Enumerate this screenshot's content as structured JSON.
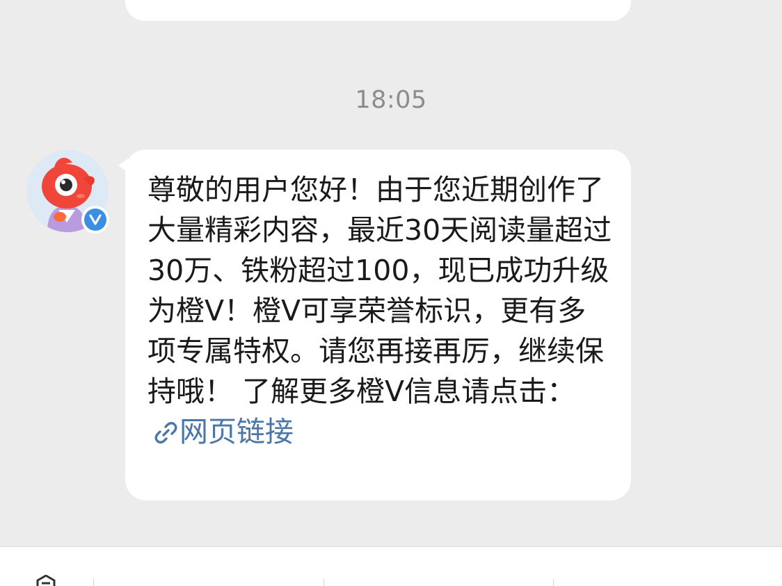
{
  "chat": {
    "timestamp": "18:05",
    "sender": {
      "avatar_icon": "mascot-avatar-icon",
      "badge_icon": "verified-v-icon",
      "badge_color": "#3a8ee6"
    },
    "message": {
      "text": "尊敬的用户您好！由于您近期创作了大量精彩内容，最近30天阅读量超过30万、铁粉超过100，现已成功升级为橙V！橙V可享荣誉标识，更有多项专属特权。请您再接再厉，继续保持哦！ 了解更多橙V信息请点击：",
      "link_icon": "link-icon",
      "link_label": "网页链接",
      "link_color": "#4a76a8"
    }
  },
  "bottom_bar": {
    "left_icon": "keyboard-icon"
  }
}
